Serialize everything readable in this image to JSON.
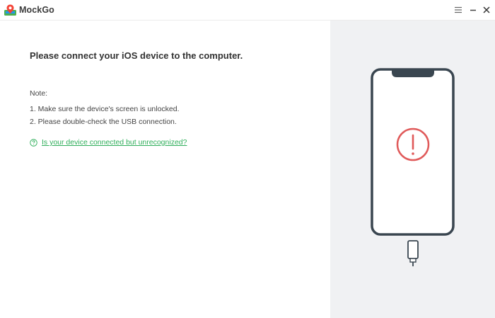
{
  "app": {
    "title": "MockGo",
    "logo_icon": "map-pin-logo-icon",
    "window_controls": [
      "menu-icon",
      "minimize-icon",
      "close-icon"
    ]
  },
  "main": {
    "headline": "Please connect your iOS device to the computer.",
    "note_title": "Note:",
    "notes": [
      "1. Make sure the device's screen is unlocked.",
      "2. Please double-check the USB connection."
    ],
    "help_link": "Is your device connected but unrecognized?",
    "help_icon": "question-circle-icon"
  },
  "illustration": {
    "device_icon": "phone-icon",
    "status_icon": "exclamation-circle-icon",
    "cable_icon": "usb-cable-icon"
  },
  "colors": {
    "accent": "#2fae5a",
    "alert": "#e05a5a",
    "phone_outline": "#3a4650",
    "panel_bg": "#f0f1f3"
  }
}
